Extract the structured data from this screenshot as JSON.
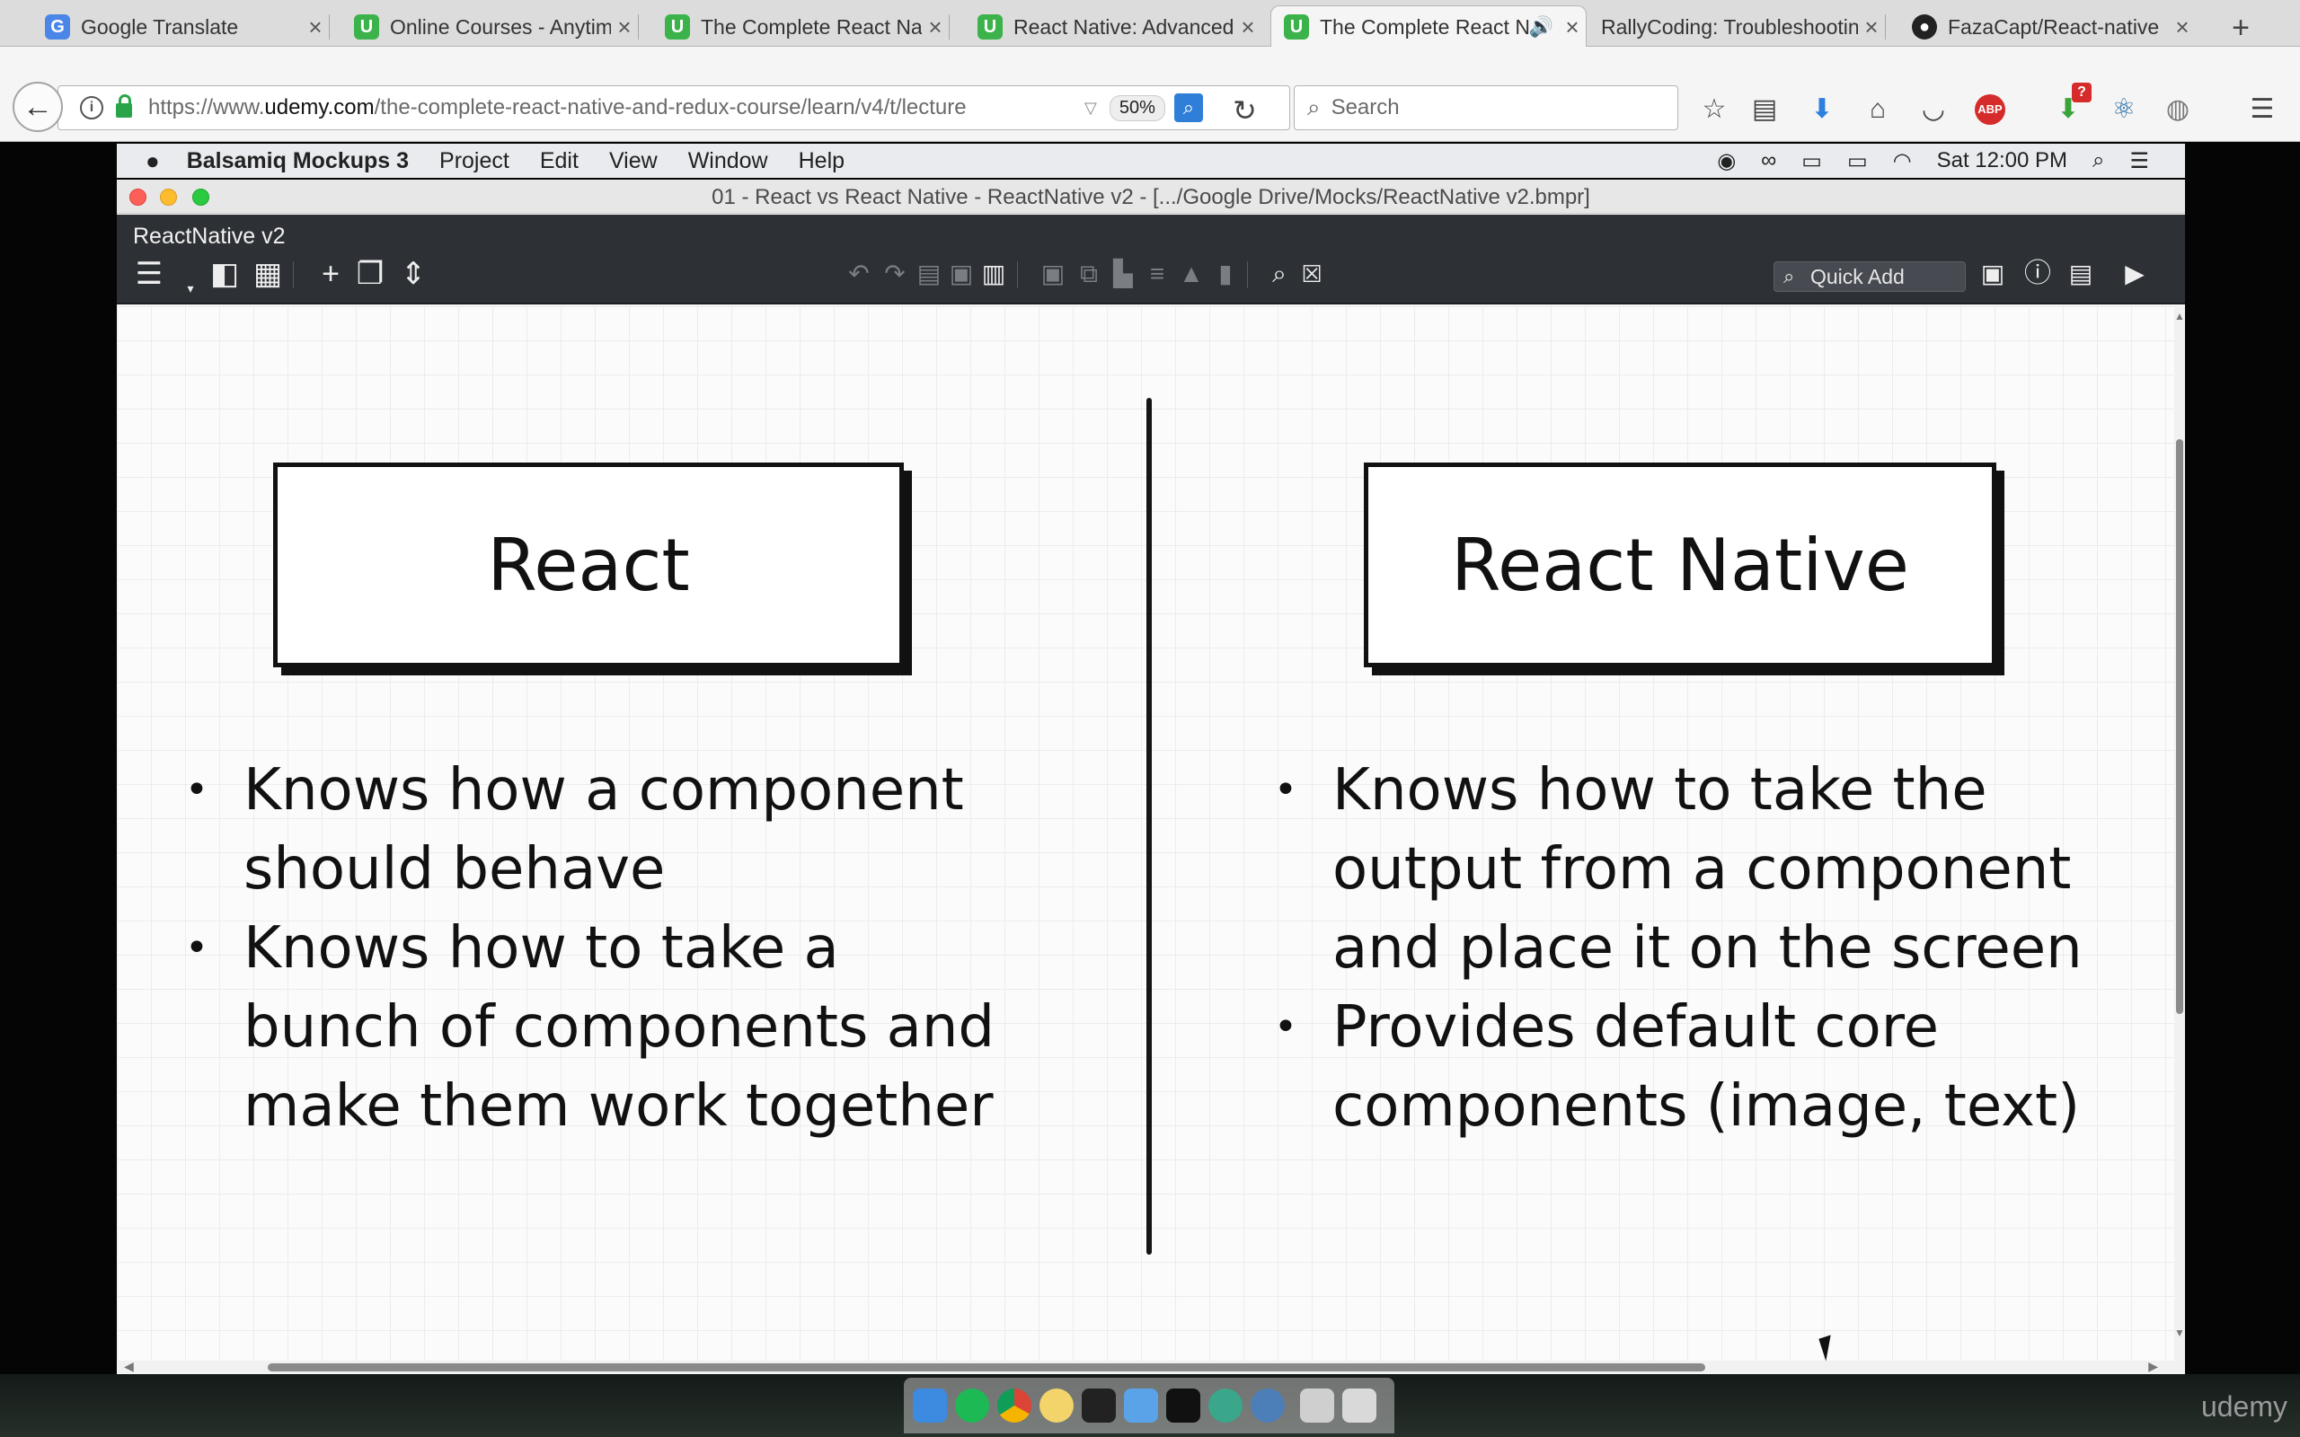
{
  "browser": {
    "tabs": [
      {
        "title": "Google Translate",
        "favicon": "google-translate-icon"
      },
      {
        "title": "Online Courses - Anytime, Anywhere",
        "favicon": "udemy-icon"
      },
      {
        "title": "The Complete React Native and Redux",
        "favicon": "udemy-icon"
      },
      {
        "title": "React Native: Advanced Concepts",
        "favicon": "udemy-icon"
      },
      {
        "title": "The Complete React Native and Redux",
        "favicon": "udemy-icon",
        "active": true
      },
      {
        "title": "RallyCoding: Troubleshooting",
        "favicon": "none"
      },
      {
        "title": "FazaCapt/React-native",
        "favicon": "github-icon"
      }
    ],
    "url_prefix": "https://www.",
    "url_domain": "udemy.com",
    "url_path": "/the-complete-react-native-and-redux-course/learn/v4/t/lecture",
    "zoom": "50%",
    "search_placeholder": "Search",
    "addon_badge": "?"
  },
  "macos": {
    "app_name": "Balsamiq Mockups 3",
    "menu": [
      "Project",
      "Edit",
      "View",
      "Window",
      "Help"
    ],
    "clock": "Sat 12:00 PM"
  },
  "window": {
    "title": "01 - React vs React Native - ReactNative v2 - [.../Google Drive/Mocks/ReactNative v2.bmpr]",
    "project_name": "ReactNative v2",
    "quick_add_placeholder": "Quick Add"
  },
  "mockup": {
    "left": {
      "heading": "React",
      "bullets": [
        {
          "lines": [
            "Knows how a component",
            "should behave"
          ]
        },
        {
          "lines": [
            "Knows how to take a",
            "bunch of components and",
            "make them work together"
          ]
        }
      ]
    },
    "right": {
      "heading": "React Native",
      "bullets": [
        {
          "lines": [
            "Knows how to take the",
            "output from a component",
            "and place it on the screen"
          ]
        },
        {
          "lines": [
            "Provides default core",
            "components (image, text)"
          ]
        }
      ]
    }
  },
  "watermark": "udemy",
  "colors": {
    "udemy_green": "#3bb34a",
    "toolbar_dark": "#2d3035",
    "sketch_ink": "#111111"
  }
}
